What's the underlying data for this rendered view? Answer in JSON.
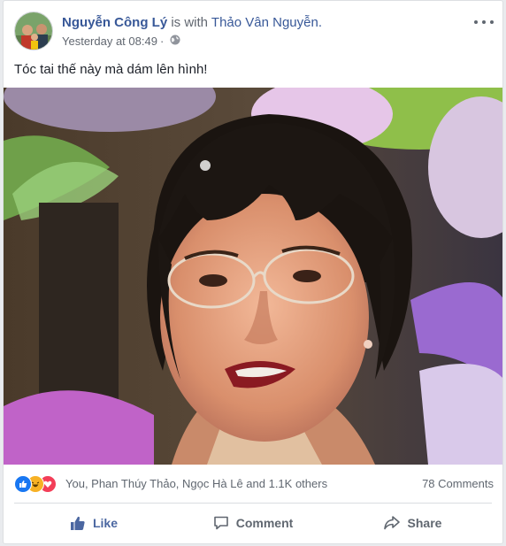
{
  "post": {
    "author": "Nguyễn Công Lý",
    "with_text": " is with ",
    "tagged": "Thảo Vân Nguyễn.",
    "timestamp": "Yesterday at 08:49",
    "separator": "·",
    "privacy_icon": "globe-icon",
    "menu_icon": "more-options-icon",
    "caption": "Tóc tai thế này mà dám lên hình!"
  },
  "reactions": {
    "icons": [
      "like-reaction-icon",
      "haha-reaction-icon",
      "love-reaction-icon"
    ],
    "summary": "You, Phan Thúy Thảo, Ngọc Hà Lê and 1.1K others",
    "comments": "78 Comments"
  },
  "actions": {
    "like": "Like",
    "comment": "Comment",
    "share": "Share"
  },
  "colors": {
    "link_blue": "#385898",
    "like_blue": "#4b67a1",
    "secondary_text": "#606770",
    "love_red": "#f33e58",
    "haha_yellow": "#f7b125"
  }
}
